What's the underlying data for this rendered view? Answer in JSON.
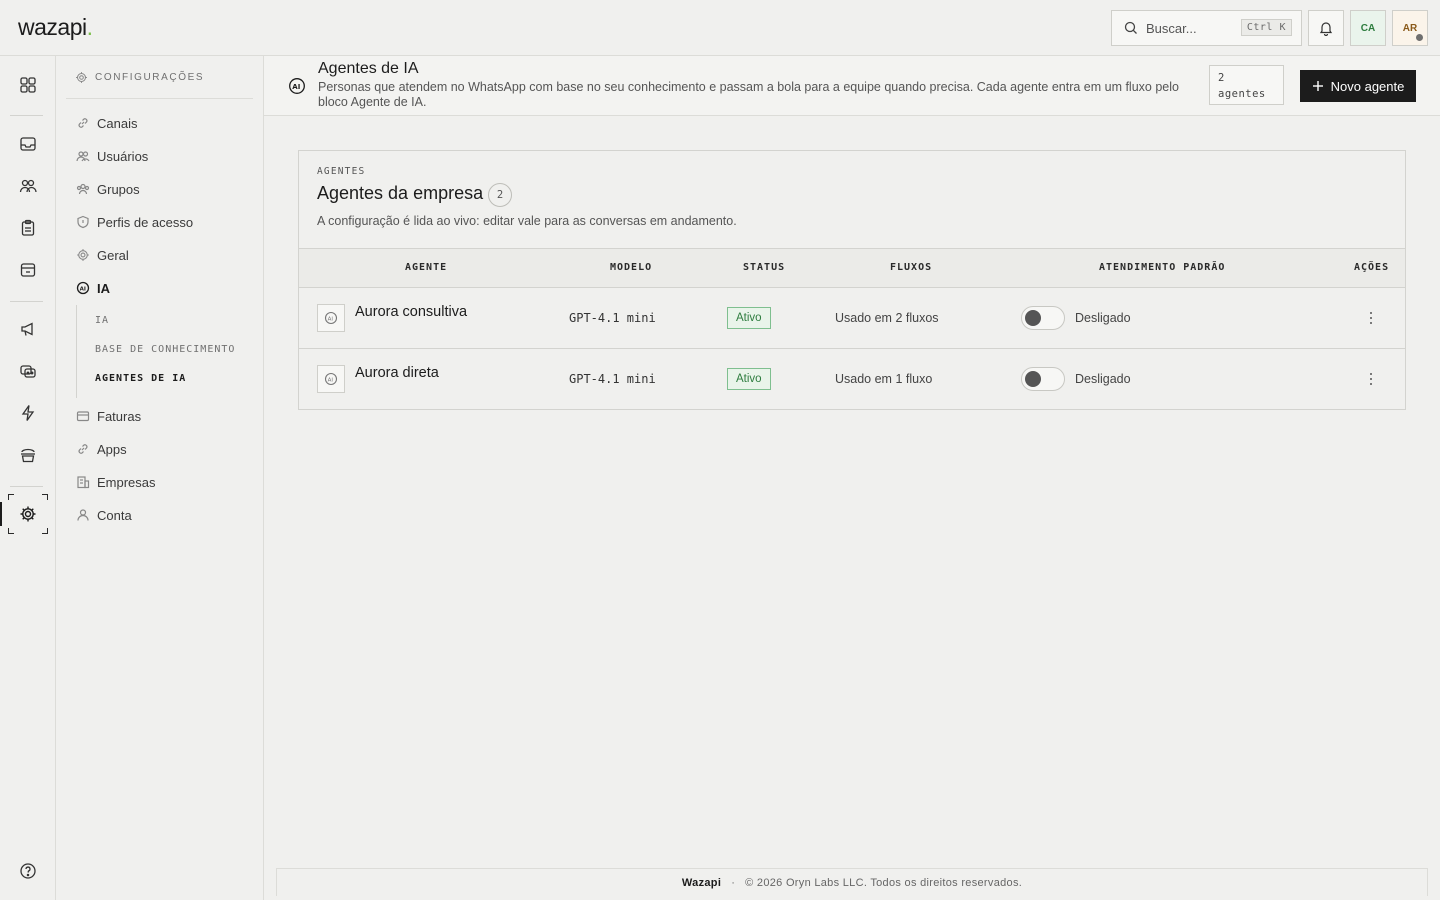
{
  "app": {
    "logo": "wazapi",
    "logo_dot": "."
  },
  "topbar": {
    "search_placeholder": "Buscar...",
    "search_shortcut": "Ctrl K",
    "avatar_org": "CA",
    "avatar_user": "AR"
  },
  "rail": {
    "icons": [
      "grid-icon",
      "inbox-icon",
      "contacts-icon",
      "clipboard-icon",
      "store-icon",
      "megaphone-icon",
      "bots-icon",
      "bolt-icon",
      "stack-icon",
      "gear-icon",
      "help-icon"
    ],
    "active": "gear-icon"
  },
  "sidebar": {
    "heading": "CONFIGURAÇÕES",
    "items": [
      {
        "label": "Canais",
        "icon": "link-icon"
      },
      {
        "label": "Usuários",
        "icon": "users-icon"
      },
      {
        "label": "Grupos",
        "icon": "group-icon"
      },
      {
        "label": "Perfis de acesso",
        "icon": "shield-icon"
      },
      {
        "label": "Geral",
        "icon": "gear-icon"
      },
      {
        "label": "IA",
        "icon": "ai-icon"
      },
      {
        "label": "Faturas",
        "icon": "invoice-icon"
      },
      {
        "label": "Apps",
        "icon": "apps-icon"
      },
      {
        "label": "Empresas",
        "icon": "building-icon"
      },
      {
        "label": "Conta",
        "icon": "user-icon"
      }
    ],
    "subitems": [
      "IA",
      "BASE DE CONHECIMENTO",
      "AGENTES DE IA"
    ],
    "active_subitem": "AGENTES DE IA"
  },
  "header": {
    "title": "Agentes de IA",
    "description": "Personas que atendem no WhatsApp com base no seu conhecimento e passam a bola para a equipe quando precisa. Cada agente entra em um fluxo pelo bloco Agente de IA.",
    "count_number": "2",
    "count_word": "agentes",
    "new_button": "Novo agente"
  },
  "card": {
    "kicker": "AGENTES",
    "title": "Agentes da empresa",
    "count": "2",
    "description": "A configuração é lida ao vivo: editar vale para as conversas em andamento.",
    "columns": [
      "AGENTE",
      "MODELO",
      "STATUS",
      "FLUXOS",
      "ATENDIMENTO PADRÃO",
      "AÇÕES"
    ],
    "rows": [
      {
        "name": "Aurora consultiva",
        "model": "GPT-4.1 mini",
        "status": "Ativo",
        "flows": "Usado em 2 fluxos",
        "default_label": "Desligado",
        "default_on": false
      },
      {
        "name": "Aurora direta",
        "model": "GPT-4.1 mini",
        "status": "Ativo",
        "flows": "Usado em 1 fluxo",
        "default_label": "Desligado",
        "default_on": false
      }
    ]
  },
  "footer": {
    "brand": "Wazapi",
    "separator": "·",
    "copyright": "© 2026 Oryn Labs LLC. Todos os direitos reservados."
  },
  "colors": {
    "accent_dark": "#1c1c1c",
    "status_green": "#2e7d3f",
    "logo_dot": "#7bbf4a",
    "background": "#f0f0ee"
  }
}
